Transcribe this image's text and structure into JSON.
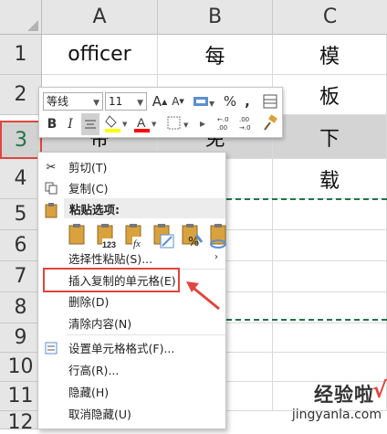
{
  "columns": [
    "A",
    "B",
    "C"
  ],
  "rows": [
    {
      "num": "1",
      "cells": [
        "officer",
        "每",
        "模"
      ]
    },
    {
      "num": "2",
      "cells": [
        "",
        "",
        "板"
      ]
    },
    {
      "num": "3",
      "cells": [
        "帝",
        "免",
        "下"
      ]
    },
    {
      "num": "4",
      "cells": [
        "",
        "",
        "载"
      ]
    },
    {
      "num": "5",
      "cells": [
        "",
        "",
        ""
      ]
    },
    {
      "num": "6",
      "cells": [
        "",
        "",
        ""
      ]
    },
    {
      "num": "7",
      "cells": [
        "",
        "",
        ""
      ]
    },
    {
      "num": "8",
      "cells": [
        "",
        "",
        ""
      ]
    },
    {
      "num": "9",
      "cells": [
        "",
        "",
        ""
      ]
    },
    {
      "num": "10",
      "cells": [
        "",
        "",
        ""
      ]
    },
    {
      "num": "11",
      "cells": [
        "",
        "",
        ""
      ]
    },
    {
      "num": "12",
      "cells": [
        "",
        "",
        ""
      ]
    }
  ],
  "selected_row": "3",
  "mini_toolbar": {
    "font_name": "等线",
    "font_size": "11",
    "bold": "B",
    "italic": "I",
    "grow_font": "A",
    "shrink_font": "A",
    "percent": "%",
    "comma": ",",
    "font_color_letter": "A",
    "fill_color": "#ffff00",
    "font_color": "#ff0000"
  },
  "context_menu": {
    "cut": "剪切(T)",
    "copy": "复制(C)",
    "paste_options_header": "粘贴选项:",
    "paste_special": "选择性粘贴(S)...",
    "insert_copied_cells": "插入复制的单元格(E)",
    "delete": "删除(D)",
    "clear_contents": "清除内容(N)",
    "format_cells": "设置单元格格式(F)...",
    "row_height": "行高(R)...",
    "hide": "隐藏(H)",
    "unhide": "取消隐藏(U)"
  },
  "paste_labels": {
    "values": "123",
    "formulas": "fx"
  },
  "watermark": {
    "text": "经验啦",
    "url": "jingyanla.com",
    "check": "√"
  },
  "colors": {
    "accent_green": "#217346",
    "highlight_red": "#e0453d"
  }
}
